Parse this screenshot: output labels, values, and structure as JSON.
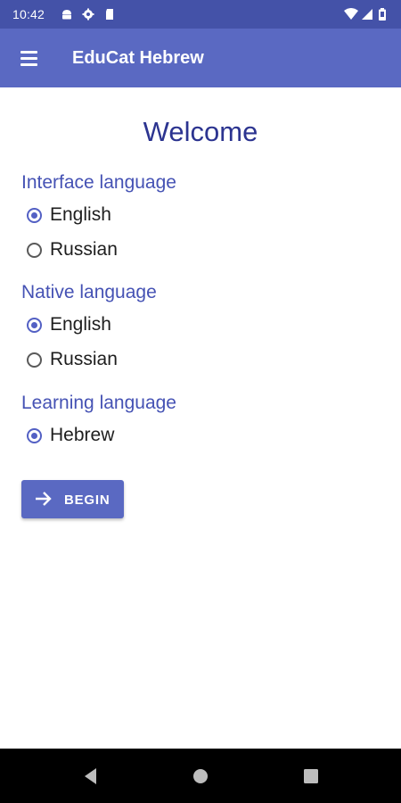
{
  "status_bar": {
    "time": "10:42",
    "left_icons": [
      "android-icon",
      "gear-icon",
      "sdcard-icon"
    ],
    "right_icons": [
      "wifi-icon",
      "signal-icon",
      "battery-icon"
    ]
  },
  "app_bar": {
    "menu_icon": "menu-icon",
    "title": "EduCat Hebrew",
    "background": "#5a69c2"
  },
  "main": {
    "heading": "Welcome",
    "sections": [
      {
        "label": "Interface language",
        "options": [
          {
            "label": "English",
            "checked": true
          },
          {
            "label": "Russian",
            "checked": false
          }
        ]
      },
      {
        "label": "Native language",
        "options": [
          {
            "label": "English",
            "checked": true
          },
          {
            "label": "Russian",
            "checked": false
          }
        ]
      },
      {
        "label": "Learning language",
        "options": [
          {
            "label": "Hebrew",
            "checked": true
          }
        ]
      }
    ],
    "begin_button": {
      "label": "BEGIN",
      "icon": "arrow-right-icon"
    }
  },
  "nav_bar": {
    "buttons": [
      "back-icon",
      "home-icon",
      "recents-icon"
    ]
  },
  "colors": {
    "accent": "#5a69c2",
    "heading": "#2c3490",
    "section_label": "#4552b4"
  }
}
